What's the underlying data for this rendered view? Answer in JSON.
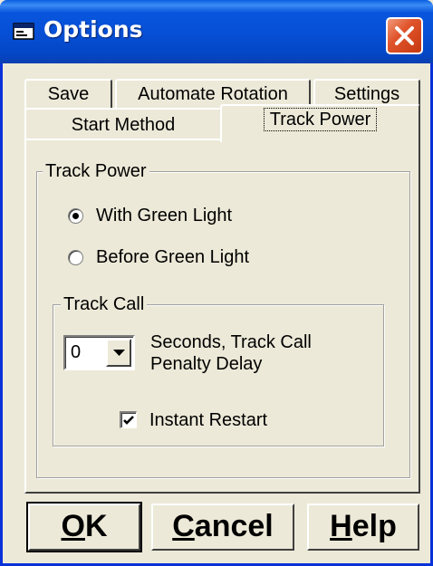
{
  "window": {
    "title": "Options",
    "icons": {
      "app": "app-window-icon",
      "close": "close-icon"
    }
  },
  "tabs": {
    "row_back": [
      {
        "label": "Save"
      },
      {
        "label": "Automate Rotation"
      },
      {
        "label": "Settings"
      }
    ],
    "row_front": [
      {
        "label": "Start Method"
      },
      {
        "label": "Track Power",
        "active": true
      }
    ]
  },
  "track_power": {
    "legend": "Track Power",
    "options": [
      {
        "label": "With Green Light",
        "selected": true
      },
      {
        "label": "Before Green Light",
        "selected": false
      }
    ]
  },
  "track_call": {
    "legend": "Track Call",
    "delay_value": "0",
    "delay_label_line1": "Seconds, Track Call",
    "delay_label_line2": "Penalty Delay",
    "instant_restart_label": "Instant Restart",
    "instant_restart_checked": true
  },
  "buttons": {
    "ok_mnemonic": "O",
    "ok_rest": "K",
    "cancel_mnemonic": "C",
    "cancel_rest": "ancel",
    "help_mnemonic": "H",
    "help_rest": "elp"
  },
  "colors": {
    "titlebar": "#0650d6",
    "close_button": "#e0542c",
    "face": "#ece9d8"
  }
}
